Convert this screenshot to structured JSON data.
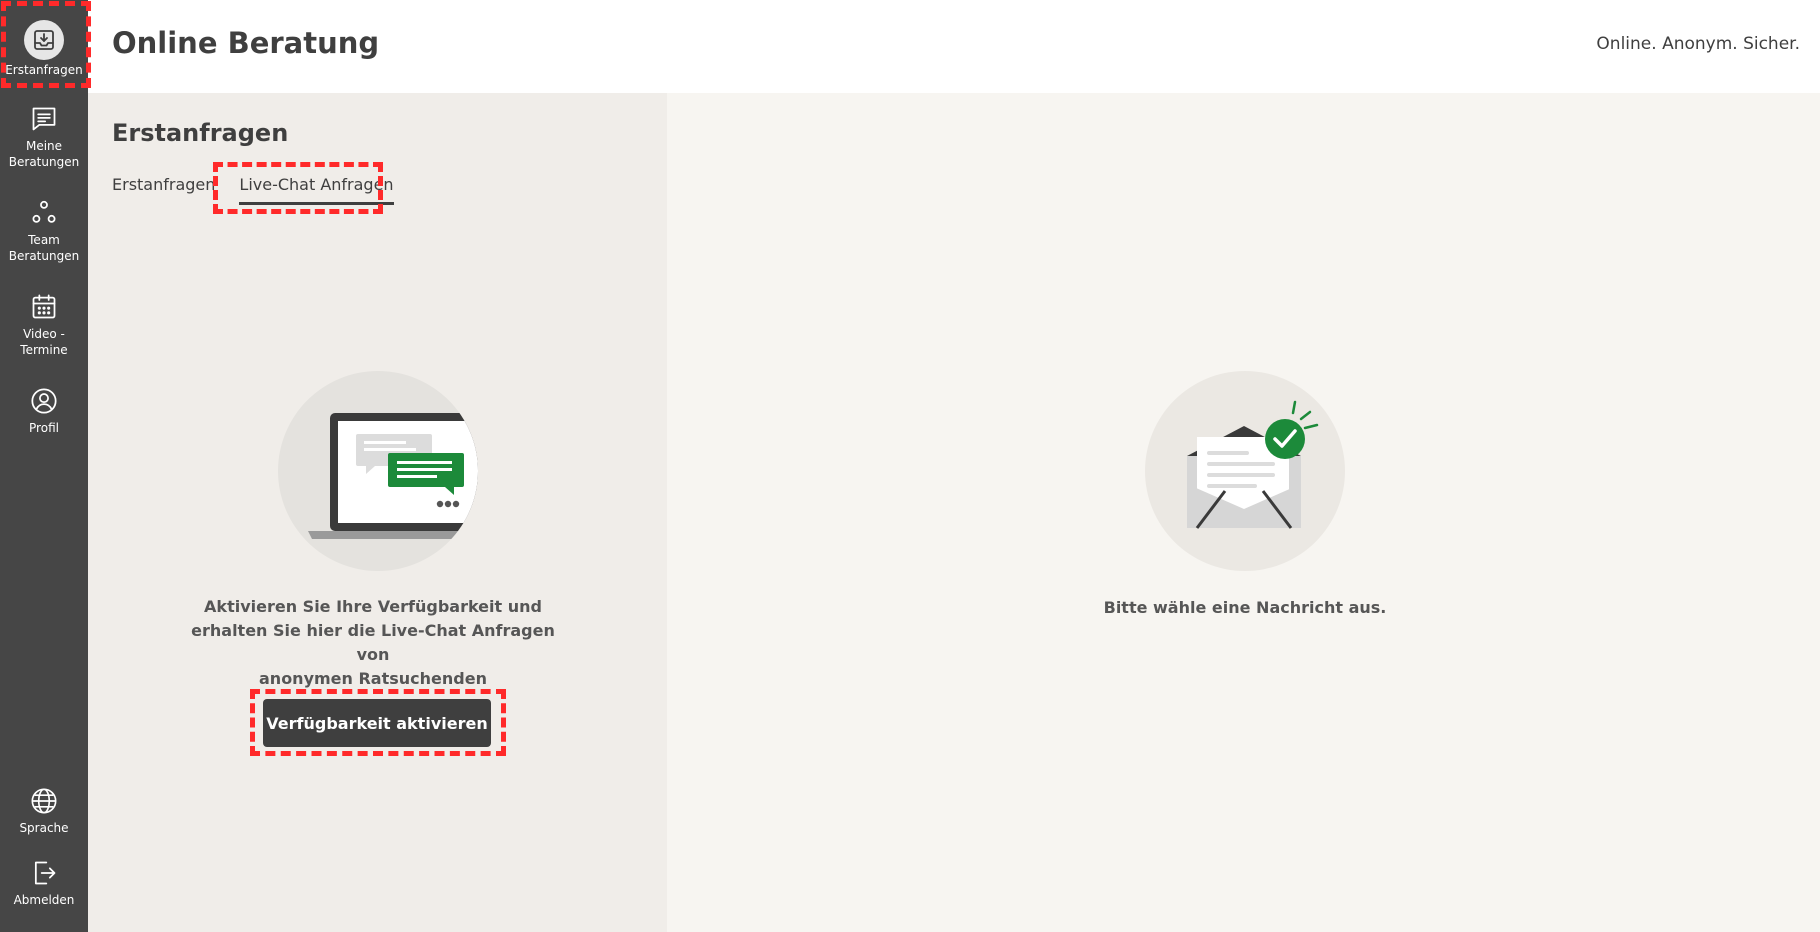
{
  "header": {
    "title": "Online Beratung",
    "tagline": "Online. Anonym. Sicher."
  },
  "sidebar": {
    "items": [
      {
        "label": "Erstanfragen",
        "icon": "inbox-download-icon",
        "active": true
      },
      {
        "label": "Meine\nBeratungen",
        "icon": "chat-message-icon",
        "active": false
      },
      {
        "label": "Team\nBeratungen",
        "icon": "team-icon",
        "active": false
      },
      {
        "label": "Video -\nTermine",
        "icon": "calendar-icon",
        "active": false
      },
      {
        "label": "Profil",
        "icon": "user-profile-icon",
        "active": false
      }
    ],
    "bottom_items": [
      {
        "label": "Sprache",
        "icon": "globe-icon"
      },
      {
        "label": "Abmelden",
        "icon": "logout-icon"
      }
    ]
  },
  "left_panel": {
    "title": "Erstanfragen",
    "tabs": [
      {
        "label": "Erstanfragen",
        "active": false
      },
      {
        "label": "Live-Chat Anfragen",
        "active": true
      }
    ],
    "illustration": "laptop-chat-illustration",
    "message": "Aktivieren Sie Ihre Verfügbarkeit und\nerhalten Sie hier die Live-Chat Anfragen von\nanonymen Ratsuchenden",
    "button_label": "Verfügbarkeit aktivieren"
  },
  "right_panel": {
    "illustration": "envelope-check-illustration",
    "message": "Bitte wähle eine Nachricht aus."
  },
  "colors": {
    "sidebar_bg": "#464646",
    "header_bg": "#ffffff",
    "left_panel_bg": "#f0ede9",
    "right_panel_bg": "#f7f5f1",
    "accent_green": "#1c8a3a",
    "button_bg": "#3f3f3f",
    "highlight": "#ff2a2a"
  }
}
